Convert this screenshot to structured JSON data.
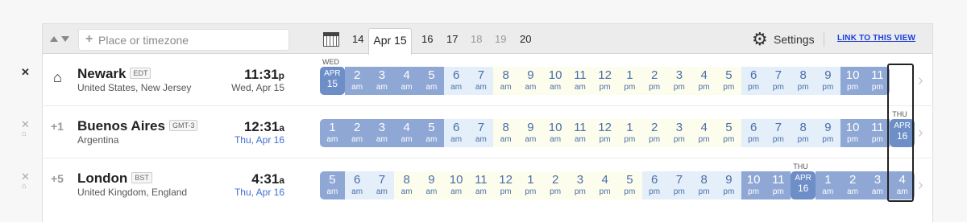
{
  "toolbar": {
    "search_placeholder": "Place or timezone",
    "date_tabs": [
      {
        "label": "14",
        "state": "normal"
      },
      {
        "label": "Apr 15",
        "state": "active"
      },
      {
        "label": "16",
        "state": "normal"
      },
      {
        "label": "17",
        "state": "normal"
      },
      {
        "label": "18",
        "state": "dim"
      },
      {
        "label": "19",
        "state": "dim"
      },
      {
        "label": "20",
        "state": "normal"
      }
    ],
    "settings_label": "Settings",
    "link_label": "LINK TO THIS VIEW"
  },
  "colors": {
    "night": "#8fa7d4",
    "morning": "#e4effa",
    "day": "#fdfdee",
    "date_cell": "#6e8ec8",
    "link": "#1a3fd8"
  },
  "rows": [
    {
      "offset": "",
      "home": true,
      "city": "Newark",
      "tz": "EDT",
      "country": "United States, New Jersey",
      "time": "11:31",
      "ampm": "p",
      "date": "Wed, Apr 15",
      "date_blue": false,
      "day_labels": [
        {
          "text": "WED",
          "at": 0
        }
      ],
      "hours": [
        {
          "h": "APR",
          "s": "15",
          "k": "date"
        },
        {
          "h": "2",
          "s": "am",
          "k": "night"
        },
        {
          "h": "3",
          "s": "am",
          "k": "night"
        },
        {
          "h": "4",
          "s": "am",
          "k": "night"
        },
        {
          "h": "5",
          "s": "am",
          "k": "night"
        },
        {
          "h": "6",
          "s": "am",
          "k": "morn"
        },
        {
          "h": "7",
          "s": "am",
          "k": "morn"
        },
        {
          "h": "8",
          "s": "am",
          "k": "day"
        },
        {
          "h": "9",
          "s": "am",
          "k": "day"
        },
        {
          "h": "10",
          "s": "am",
          "k": "day"
        },
        {
          "h": "11",
          "s": "am",
          "k": "day"
        },
        {
          "h": "12",
          "s": "pm",
          "k": "day"
        },
        {
          "h": "1",
          "s": "pm",
          "k": "day"
        },
        {
          "h": "2",
          "s": "pm",
          "k": "day"
        },
        {
          "h": "3",
          "s": "pm",
          "k": "day"
        },
        {
          "h": "4",
          "s": "pm",
          "k": "day"
        },
        {
          "h": "5",
          "s": "pm",
          "k": "day"
        },
        {
          "h": "6",
          "s": "pm",
          "k": "eve"
        },
        {
          "h": "7",
          "s": "pm",
          "k": "eve"
        },
        {
          "h": "8",
          "s": "pm",
          "k": "eve"
        },
        {
          "h": "9",
          "s": "pm",
          "k": "eve"
        },
        {
          "h": "10",
          "s": "pm",
          "k": "night"
        },
        {
          "h": "11",
          "s": "pm",
          "k": "night"
        }
      ]
    },
    {
      "offset": "+1",
      "home": false,
      "city": "Buenos Aires",
      "tz": "GMT-3",
      "country": "Argentina",
      "time": "12:31",
      "ampm": "a",
      "date": "Thu, Apr 16",
      "date_blue": true,
      "day_labels": [
        {
          "text": "THU",
          "at": 23
        }
      ],
      "hours": [
        {
          "h": "1",
          "s": "am",
          "k": "night"
        },
        {
          "h": "2",
          "s": "am",
          "k": "night"
        },
        {
          "h": "3",
          "s": "am",
          "k": "night"
        },
        {
          "h": "4",
          "s": "am",
          "k": "night"
        },
        {
          "h": "5",
          "s": "am",
          "k": "night"
        },
        {
          "h": "6",
          "s": "am",
          "k": "morn"
        },
        {
          "h": "7",
          "s": "am",
          "k": "morn"
        },
        {
          "h": "8",
          "s": "am",
          "k": "day"
        },
        {
          "h": "9",
          "s": "am",
          "k": "day"
        },
        {
          "h": "10",
          "s": "am",
          "k": "day"
        },
        {
          "h": "11",
          "s": "am",
          "k": "day"
        },
        {
          "h": "12",
          "s": "pm",
          "k": "day"
        },
        {
          "h": "1",
          "s": "pm",
          "k": "day"
        },
        {
          "h": "2",
          "s": "pm",
          "k": "day"
        },
        {
          "h": "3",
          "s": "pm",
          "k": "day"
        },
        {
          "h": "4",
          "s": "pm",
          "k": "day"
        },
        {
          "h": "5",
          "s": "pm",
          "k": "day"
        },
        {
          "h": "6",
          "s": "pm",
          "k": "eve"
        },
        {
          "h": "7",
          "s": "pm",
          "k": "eve"
        },
        {
          "h": "8",
          "s": "pm",
          "k": "eve"
        },
        {
          "h": "9",
          "s": "pm",
          "k": "eve"
        },
        {
          "h": "10",
          "s": "pm",
          "k": "night"
        },
        {
          "h": "11",
          "s": "pm",
          "k": "night"
        },
        {
          "h": "APR",
          "s": "16",
          "k": "date"
        }
      ]
    },
    {
      "offset": "+5",
      "home": false,
      "city": "London",
      "tz": "BST",
      "country": "United Kingdom, England",
      "time": "4:31",
      "ampm": "a",
      "date": "Thu, Apr 16",
      "date_blue": true,
      "day_labels": [
        {
          "text": "THU",
          "at": 19
        }
      ],
      "hours": [
        {
          "h": "5",
          "s": "am",
          "k": "night"
        },
        {
          "h": "6",
          "s": "am",
          "k": "morn"
        },
        {
          "h": "7",
          "s": "am",
          "k": "morn"
        },
        {
          "h": "8",
          "s": "am",
          "k": "day"
        },
        {
          "h": "9",
          "s": "am",
          "k": "day"
        },
        {
          "h": "10",
          "s": "am",
          "k": "day"
        },
        {
          "h": "11",
          "s": "am",
          "k": "day"
        },
        {
          "h": "12",
          "s": "pm",
          "k": "day"
        },
        {
          "h": "1",
          "s": "pm",
          "k": "day"
        },
        {
          "h": "2",
          "s": "pm",
          "k": "day"
        },
        {
          "h": "3",
          "s": "pm",
          "k": "day"
        },
        {
          "h": "4",
          "s": "pm",
          "k": "day"
        },
        {
          "h": "5",
          "s": "pm",
          "k": "day"
        },
        {
          "h": "6",
          "s": "pm",
          "k": "eve"
        },
        {
          "h": "7",
          "s": "pm",
          "k": "eve"
        },
        {
          "h": "8",
          "s": "pm",
          "k": "eve"
        },
        {
          "h": "9",
          "s": "pm",
          "k": "eve"
        },
        {
          "h": "10",
          "s": "pm",
          "k": "night"
        },
        {
          "h": "11",
          "s": "pm",
          "k": "night"
        },
        {
          "h": "APR",
          "s": "16",
          "k": "date"
        },
        {
          "h": "1",
          "s": "am",
          "k": "night"
        },
        {
          "h": "2",
          "s": "am",
          "k": "night"
        },
        {
          "h": "3",
          "s": "am",
          "k": "night"
        },
        {
          "h": "4",
          "s": "am",
          "k": "night"
        }
      ]
    }
  ]
}
